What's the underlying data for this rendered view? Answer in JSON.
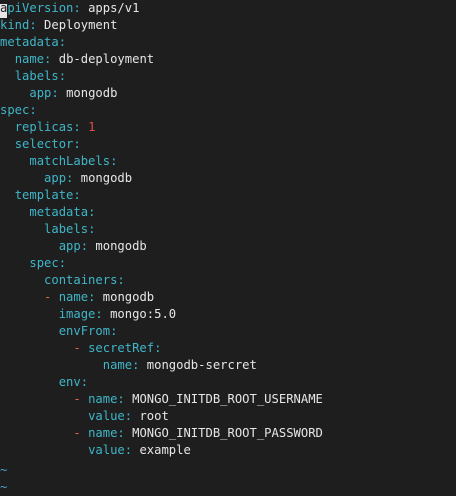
{
  "editor": {
    "lines": [
      {
        "indent": "",
        "dash": "",
        "key": "apiVersion",
        "value": "apps/v1",
        "vclass": "v",
        "cursor": true
      },
      {
        "indent": "",
        "dash": "",
        "key": "kind",
        "value": "Deployment",
        "vclass": "v"
      },
      {
        "indent": "",
        "dash": "",
        "key": "metadata",
        "value": "",
        "vclass": "v"
      },
      {
        "indent": "  ",
        "dash": "",
        "key": "name",
        "value": "db-deployment",
        "vclass": "v"
      },
      {
        "indent": "  ",
        "dash": "",
        "key": "labels",
        "value": "",
        "vclass": "v"
      },
      {
        "indent": "    ",
        "dash": "",
        "key": "app",
        "value": "mongodb",
        "vclass": "v"
      },
      {
        "indent": "",
        "dash": "",
        "key": "spec",
        "value": "",
        "vclass": "v"
      },
      {
        "indent": "  ",
        "dash": "",
        "key": "replicas",
        "value": "1",
        "vclass": "n"
      },
      {
        "indent": "  ",
        "dash": "",
        "key": "selector",
        "value": "",
        "vclass": "v"
      },
      {
        "indent": "    ",
        "dash": "",
        "key": "matchLabels",
        "value": "",
        "vclass": "v"
      },
      {
        "indent": "      ",
        "dash": "",
        "key": "app",
        "value": "mongodb",
        "vclass": "v"
      },
      {
        "indent": "  ",
        "dash": "",
        "key": "template",
        "value": "",
        "vclass": "v"
      },
      {
        "indent": "    ",
        "dash": "",
        "key": "metadata",
        "value": "",
        "vclass": "v"
      },
      {
        "indent": "      ",
        "dash": "",
        "key": "labels",
        "value": "",
        "vclass": "v"
      },
      {
        "indent": "        ",
        "dash": "",
        "key": "app",
        "value": "mongodb",
        "vclass": "v"
      },
      {
        "indent": "    ",
        "dash": "",
        "key": "spec",
        "value": "",
        "vclass": "v"
      },
      {
        "indent": "      ",
        "dash": "",
        "key": "containers",
        "value": "",
        "vclass": "v"
      },
      {
        "indent": "      ",
        "dash": "- ",
        "key": "name",
        "value": "mongodb",
        "vclass": "v"
      },
      {
        "indent": "        ",
        "dash": "",
        "key": "image",
        "value": "mongo:5.0",
        "vclass": "v"
      },
      {
        "indent": "        ",
        "dash": "",
        "key": "envFrom",
        "value": "",
        "vclass": "v"
      },
      {
        "indent": "          ",
        "dash": "- ",
        "key": "secretRef",
        "value": "",
        "vclass": "v"
      },
      {
        "indent": "              ",
        "dash": "",
        "key": "name",
        "value": "mongodb-sercret",
        "vclass": "v"
      },
      {
        "indent": "        ",
        "dash": "",
        "key": "env",
        "value": "",
        "vclass": "v"
      },
      {
        "indent": "          ",
        "dash": "- ",
        "key": "name",
        "value": "MONGO_INITDB_ROOT_USERNAME",
        "vclass": "v"
      },
      {
        "indent": "            ",
        "dash": "",
        "key": "value",
        "value": "root",
        "vclass": "v"
      },
      {
        "indent": "          ",
        "dash": "- ",
        "key": "name",
        "value": "MONGO_INITDB_ROOT_PASSWORD",
        "vclass": "v"
      },
      {
        "indent": "            ",
        "dash": "",
        "key": "value",
        "value": "example",
        "vclass": "v"
      }
    ],
    "tildes": [
      "~",
      "~"
    ],
    "colors": {
      "background": "#1e1e1e",
      "key": "#3fb6c8",
      "value": "#e6e6e6",
      "dash": "#e06c3c",
      "number": "#e34b4b",
      "tilde": "#4aa3c8"
    }
  }
}
